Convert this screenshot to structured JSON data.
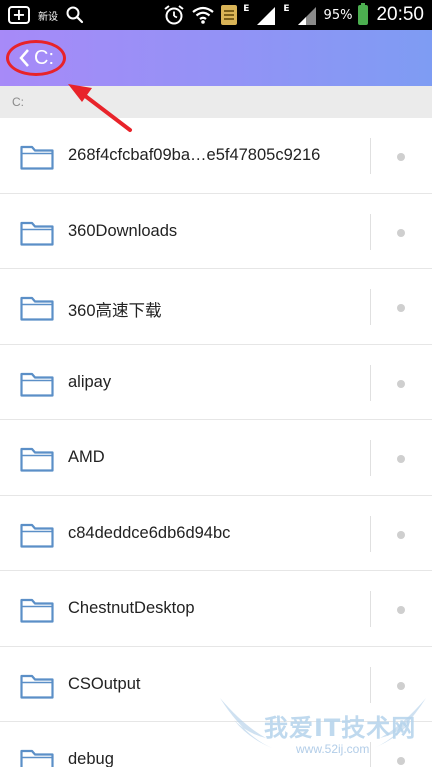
{
  "statusbar": {
    "small_label": "新设",
    "signal_e1": "E",
    "signal_e2": "E",
    "battery_percent": "95%",
    "time": "20:50"
  },
  "header": {
    "back_label": "C:"
  },
  "breadcrumb": {
    "path": "C:"
  },
  "folders": [
    {
      "name": "268f4cfcbaf09ba…e5f47805c9216"
    },
    {
      "name": "360Downloads"
    },
    {
      "name": "360高速下载"
    },
    {
      "name": "alipay"
    },
    {
      "name": "AMD"
    },
    {
      "name": "c84deddce6db6d94bc"
    },
    {
      "name": "ChestnutDesktop"
    },
    {
      "name": "CSOutput"
    },
    {
      "name": "debug"
    }
  ],
  "watermark": {
    "text": "我爱IT技术网",
    "url": "www.52ij.com"
  },
  "colors": {
    "appbar_start": "#a78af8",
    "appbar_end": "#7e9cf3",
    "highlight_red": "#e8232a",
    "folder_blue": "#5b8fc7"
  }
}
